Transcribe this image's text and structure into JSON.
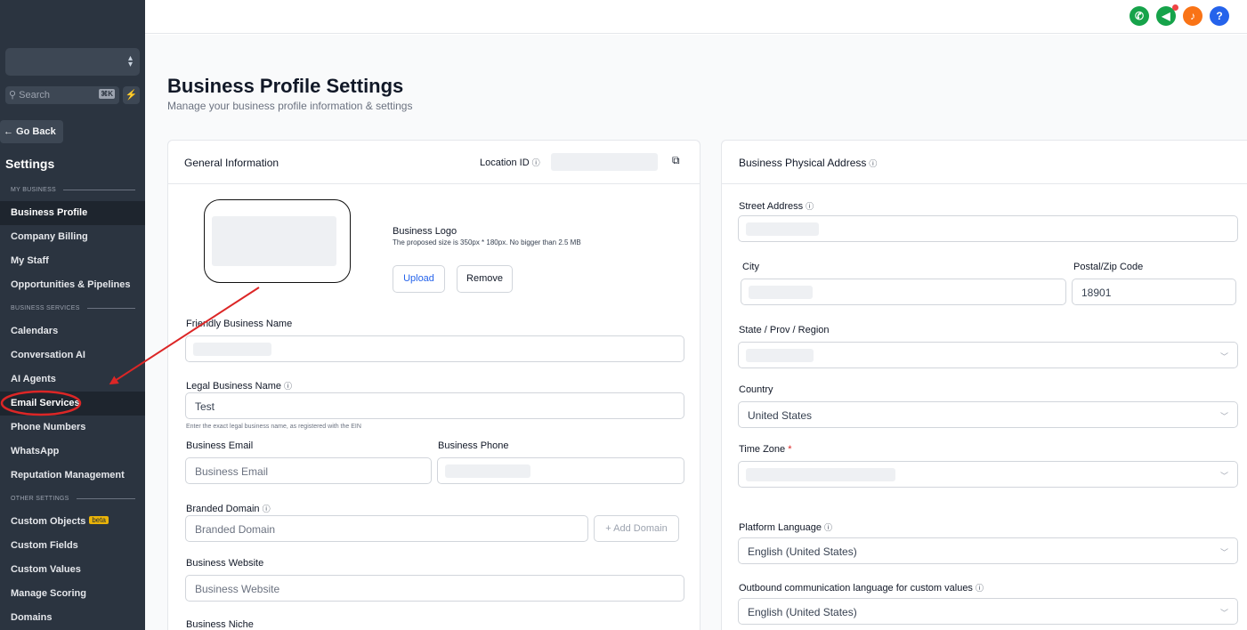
{
  "sidebar": {
    "search_placeholder": "Search",
    "search_shortcut": "⌘K",
    "go_back": "← Go Back",
    "title": "Settings",
    "sections": {
      "my_business": "MY BUSINESS",
      "business_services": "BUSINESS SERVICES",
      "other_settings": "OTHER SETTINGS"
    },
    "items": [
      {
        "label": "Business Profile",
        "active": true
      },
      {
        "label": "Company Billing"
      },
      {
        "label": "My Staff"
      },
      {
        "label": "Opportunities & Pipelines"
      },
      {
        "label": "Calendars"
      },
      {
        "label": "Conversation AI"
      },
      {
        "label": "AI Agents"
      },
      {
        "label": "Email Services",
        "highlighted": true
      },
      {
        "label": "Phone Numbers"
      },
      {
        "label": "WhatsApp"
      },
      {
        "label": "Reputation Management"
      },
      {
        "label": "Custom Objects",
        "badge": "beta"
      },
      {
        "label": "Custom Fields"
      },
      {
        "label": "Custom Values"
      },
      {
        "label": "Manage Scoring"
      },
      {
        "label": "Domains"
      }
    ]
  },
  "topbar": {
    "icons": [
      "phone-icon",
      "megaphone-icon",
      "bell-icon",
      "help-icon"
    ],
    "help_glyph": "?"
  },
  "page": {
    "title": "Business Profile Settings",
    "subtitle": "Manage your business profile information & settings"
  },
  "general": {
    "heading": "General Information",
    "location_id_label": "Location ID",
    "logo_label": "Business Logo",
    "logo_hint": "The proposed size is 350px * 180px. No bigger than 2.5 MB",
    "upload": "Upload",
    "remove": "Remove",
    "friendly_name_label": "Friendly Business Name",
    "legal_name_label": "Legal Business Name",
    "legal_name_value": "Test",
    "legal_name_hint": "Enter the exact legal business name, as registered with the EIN",
    "email_label": "Business Email",
    "email_placeholder": "Business Email",
    "phone_label": "Business Phone",
    "branded_domain_label": "Branded Domain",
    "branded_domain_placeholder": "Branded Domain",
    "add_domain": "+ Add Domain",
    "website_label": "Business Website",
    "website_placeholder": "Business Website",
    "niche_label": "Business Niche"
  },
  "address": {
    "heading": "Business Physical Address",
    "street_label": "Street Address",
    "city_label": "City",
    "postal_label": "Postal/Zip Code",
    "postal_value": "18901",
    "state_label": "State / Prov / Region",
    "country_label": "Country",
    "country_value": "United States",
    "timezone_label": "Time Zone",
    "required_mark": "*",
    "platform_lang_label": "Platform Language",
    "platform_lang_value": "English (United States)",
    "outbound_lang_label": "Outbound communication language for custom values",
    "outbound_lang_value": "English (United States)"
  },
  "colors": {
    "sidebar_bg": "#2b3440",
    "annotation_red": "#dc2626",
    "phone_green": "#16a34a",
    "bell_orange": "#f97316",
    "help_blue": "#2563eb",
    "link_blue": "#2563eb"
  }
}
